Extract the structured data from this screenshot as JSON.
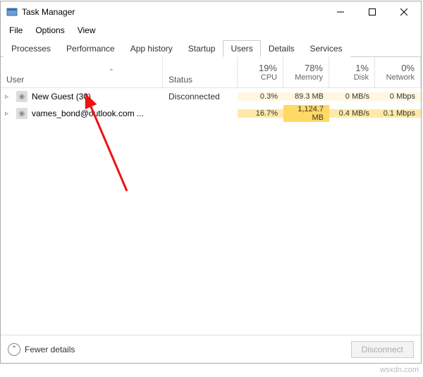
{
  "window": {
    "title": "Task Manager"
  },
  "menu": {
    "file": "File",
    "options": "Options",
    "view": "View"
  },
  "tabs": {
    "processes": "Processes",
    "performance": "Performance",
    "app_history": "App history",
    "startup": "Startup",
    "users": "Users",
    "details": "Details",
    "services": "Services"
  },
  "headers": {
    "user": "User",
    "status": "Status",
    "cpu": {
      "pct": "19%",
      "label": "CPU"
    },
    "memory": {
      "pct": "78%",
      "label": "Memory"
    },
    "disk": {
      "pct": "1%",
      "label": "Disk"
    },
    "network": {
      "pct": "0%",
      "label": "Network"
    }
  },
  "rows": [
    {
      "name": "New Guest (30)",
      "status": "Disconnected",
      "cpu": "0.3%",
      "memory": "89.3 MB",
      "disk": "0 MB/s",
      "network": "0 Mbps"
    },
    {
      "name": "vames_bond@outlook.com ...",
      "status": "",
      "cpu": "16.7%",
      "memory": "1,124.7 MB",
      "disk": "0.4 MB/s",
      "network": "0.1 Mbps"
    }
  ],
  "footer": {
    "fewer": "Fewer details",
    "disconnect": "Disconnect"
  },
  "watermark": "wsxdn.com"
}
